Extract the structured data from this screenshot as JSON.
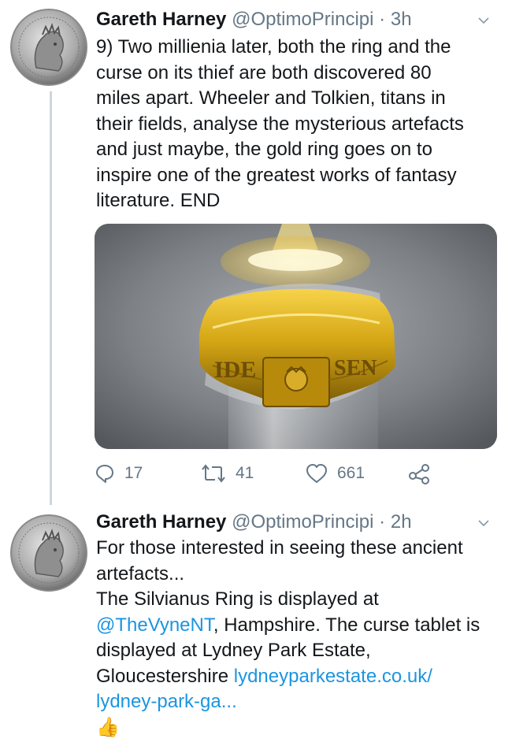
{
  "tweets": [
    {
      "author": {
        "name": "Gareth Harney",
        "handle": "@OptimoPrincipi"
      },
      "separator": "·",
      "time": "3h",
      "text_lines": [
        "9) Two millienia later, both the ring and the",
        "curse on its thief are both discovered 80",
        "miles apart. Wheeler and Tolkien, titans in",
        "their fields, analyse the mysterious artefacts",
        "and just maybe, the gold ring goes on to",
        "inspire one of the greatest works of fantasy",
        "literature. END"
      ],
      "media": {
        "ring_letters_left": "IDE",
        "ring_letters_right": "SEN"
      },
      "actions": {
        "replies": "17",
        "retweets": "41",
        "likes": "661"
      }
    },
    {
      "author": {
        "name": "Gareth Harney",
        "handle": "@OptimoPrincipi"
      },
      "separator": "·",
      "time": "2h",
      "line1": "For those interested in seeing these ancient",
      "line2": "artefacts...",
      "line3": "The Silvianus Ring is displayed at",
      "mention": "@TheVyneNT",
      "line4_rest": ", Hampshire. The curse tablet is",
      "line5": "displayed at Lydney Park Estate,",
      "line6_text": "Gloucestershire ",
      "link_part1": "lydneyparkestate.co.uk/",
      "link_part2": "lydney-park-ga...",
      "emoji": "👍"
    }
  ],
  "colors": {
    "link": "#1b95e0",
    "secondary": "#657786",
    "thread_line": "#ccd6dd",
    "gold": "#d4a514"
  },
  "icons": [
    "reply-icon",
    "retweet-icon",
    "like-icon",
    "share-icon",
    "chevron-down-icon",
    "coin-avatar"
  ]
}
